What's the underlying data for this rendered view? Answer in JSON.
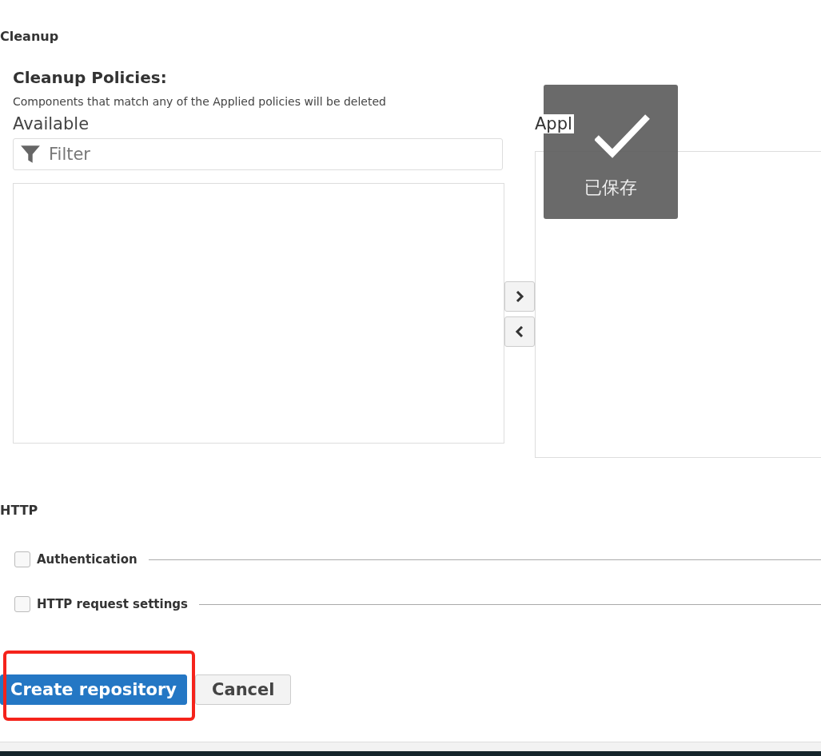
{
  "cleanup": {
    "title": "Cleanup",
    "policies_title": "Cleanup Policies:",
    "description": "Components that match any of the Applied policies will be deleted",
    "available": {
      "label": "Available",
      "filter": {
        "placeholder": "Filter"
      }
    },
    "move_buttons": [
      {
        "kind": "add"
      },
      {
        "kind": "remove"
      }
    ],
    "applied": {
      "label": "Appl"
    }
  },
  "toast": {
    "message": "已保存"
  },
  "http": {
    "title": "HTTP",
    "options": [
      {
        "label": "Authentication",
        "checked": false
      },
      {
        "label": "HTTP request settings",
        "checked": false
      }
    ]
  },
  "buttons": [
    {
      "label": "Create repository",
      "kind": "primary",
      "highlighted": true
    },
    {
      "label": "Cancel",
      "kind": "secondary",
      "highlighted": false
    }
  ]
}
